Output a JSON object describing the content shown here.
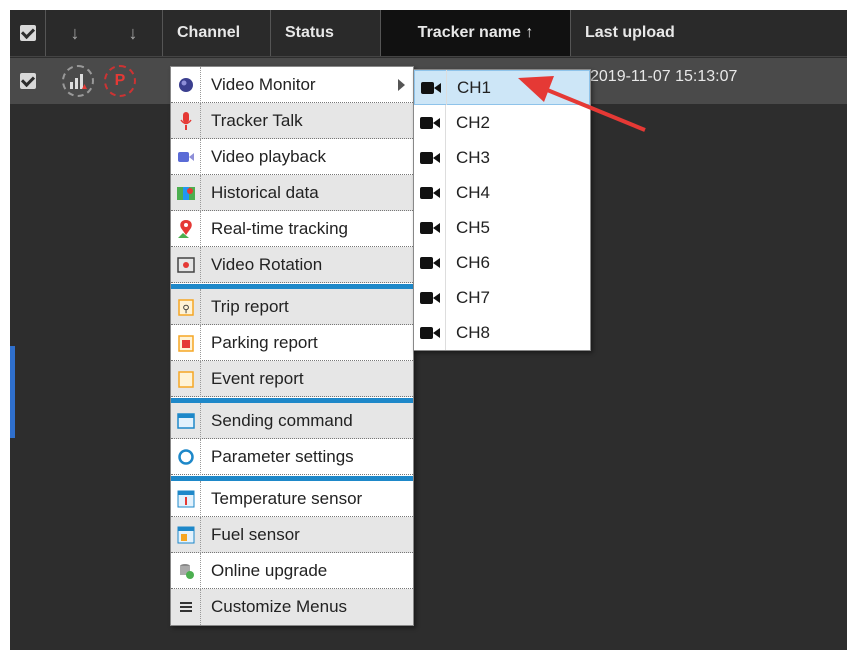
{
  "table": {
    "columns": [
      "Channel",
      "Status",
      "Tracker name",
      "Last upload"
    ],
    "sort_indicator": "↑",
    "row": {
      "last_upload": "2019-11-07 15:13:07"
    }
  },
  "context_menu": {
    "items": [
      {
        "label": "Video Monitor",
        "icon": "globe-icon"
      },
      {
        "label": "Tracker Talk",
        "icon": "microphone-icon"
      },
      {
        "label": "Video playback",
        "icon": "video-camera-icon"
      },
      {
        "label": "Historical data",
        "icon": "map-icon"
      },
      {
        "label": "Real-time tracking",
        "icon": "location-pin-icon"
      },
      {
        "label": "Video Rotation",
        "icon": "video-rotation-icon"
      },
      {
        "label": "Trip report",
        "icon": "trip-report-icon"
      },
      {
        "label": "Parking report",
        "icon": "parking-report-icon"
      },
      {
        "label": "Event report",
        "icon": "event-report-icon"
      },
      {
        "label": "Sending command",
        "icon": "command-icon"
      },
      {
        "label": "Parameter settings",
        "icon": "settings-ring-icon"
      },
      {
        "label": "Temperature sensor",
        "icon": "thermometer-icon"
      },
      {
        "label": "Fuel sensor",
        "icon": "fuel-icon"
      },
      {
        "label": "Online upgrade",
        "icon": "upgrade-icon"
      },
      {
        "label": "Customize Menus",
        "icon": "list-icon"
      }
    ]
  },
  "submenu": {
    "items": [
      "CH1",
      "CH2",
      "CH3",
      "CH4",
      "CH5",
      "CH6",
      "CH7",
      "CH8"
    ],
    "active": "CH1"
  },
  "colors": {
    "accent": "#1e88c9",
    "annotation_arrow": "#e53935",
    "selection": "#cde6f7"
  }
}
